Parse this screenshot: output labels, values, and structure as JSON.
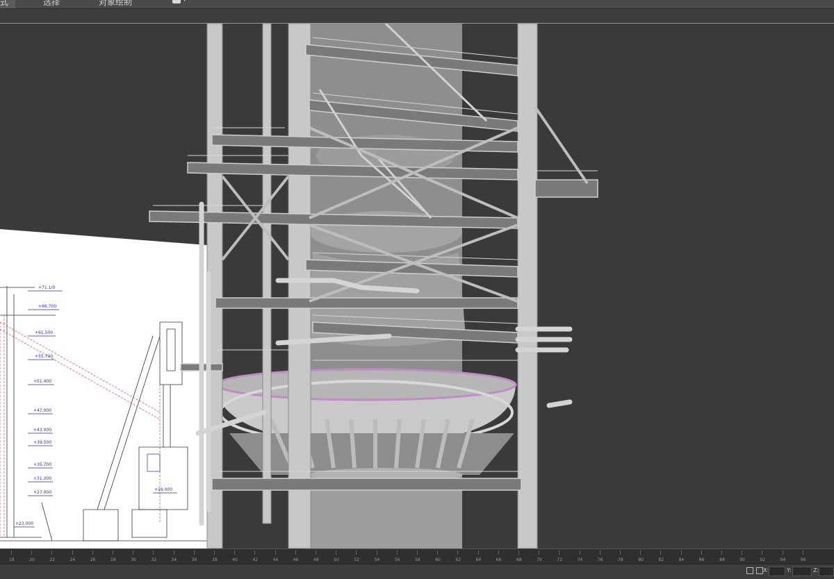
{
  "ribbon": {
    "tabs": [
      {
        "label": "式",
        "active": true
      },
      {
        "label": "选择",
        "active": false
      },
      {
        "label": "对象绘制",
        "active": false
      }
    ]
  },
  "timeline": {
    "ticks": [
      "18",
      "20",
      "22",
      "24",
      "26",
      "28",
      "30",
      "32",
      "34",
      "36",
      "38",
      "40",
      "42",
      "44",
      "46",
      "48",
      "50",
      "52",
      "54",
      "56",
      "58",
      "60",
      "62",
      "64",
      "66",
      "68",
      "70",
      "72",
      "74",
      "76",
      "78",
      "80",
      "82",
      "84",
      "86",
      "88",
      "90",
      "92",
      "94",
      "96"
    ]
  },
  "statusbar": {
    "x_label": "X:",
    "y_label": "Y:",
    "z_label": "Z:"
  },
  "drawing": {
    "elevations": [
      "+71.1/0",
      "+66.700",
      "+61.500",
      "+55.700",
      "+51.400",
      "+47.000",
      "+43.000",
      "+39.500",
      "+35.700",
      "+31.200",
      "+27.000",
      "+23.000",
      "+19.000",
      "+16.000",
      "+11.400"
    ]
  },
  "colors": {
    "viewport_bg": "#3a3a3a",
    "structure": "#b8b8b8",
    "accent_line": "#b99a40",
    "ring_highlight": "#c38ac9"
  }
}
